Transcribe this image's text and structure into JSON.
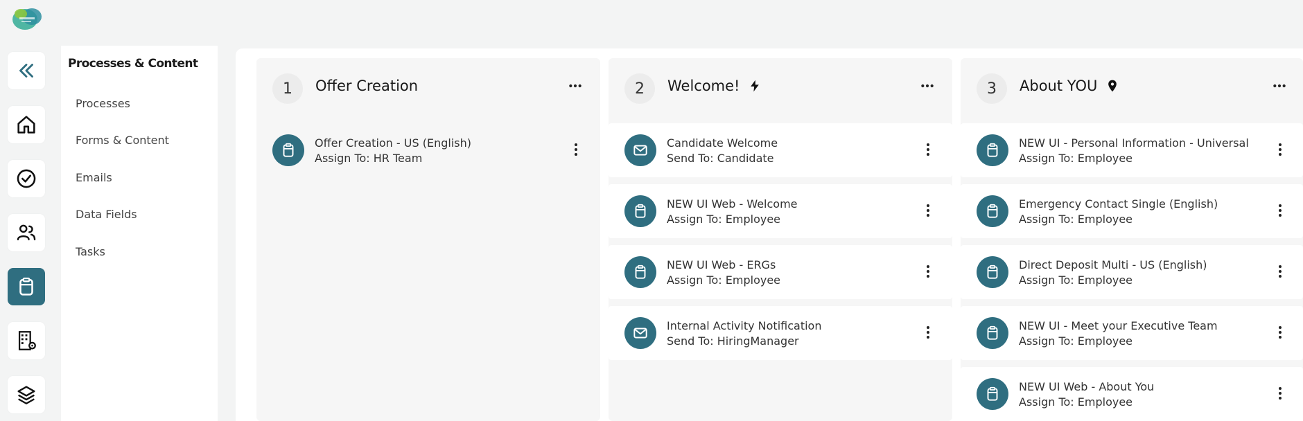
{
  "sidebar": {
    "icons": [
      "collapse-icon",
      "home-icon",
      "check-circle-icon",
      "people-icon",
      "clipboard-icon",
      "building-gear-icon",
      "layers-icon"
    ],
    "active_index": 4
  },
  "subnav": {
    "title": "Processes & Content",
    "items": [
      {
        "label": "Processes"
      },
      {
        "label": "Forms & Content"
      },
      {
        "label": "Emails"
      },
      {
        "label": "Data Fields"
      },
      {
        "label": "Tasks"
      }
    ]
  },
  "columns": [
    {
      "number": "1",
      "title": "Offer Creation",
      "title_icon": "",
      "steps": [
        {
          "icon": "clipboard-icon",
          "name": "Offer Creation - US (English)",
          "assign": "Assign To: HR Team"
        }
      ]
    },
    {
      "number": "2",
      "title": "Welcome!",
      "title_icon": "lightning-icon",
      "steps": [
        {
          "icon": "envelope-icon",
          "name": "Candidate Welcome",
          "assign": "Send To: Candidate"
        },
        {
          "icon": "clipboard-icon",
          "name": "NEW UI Web - Welcome",
          "assign": "Assign To: Employee"
        },
        {
          "icon": "clipboard-icon",
          "name": "NEW UI Web - ERGs",
          "assign": "Assign To: Employee"
        },
        {
          "icon": "envelope-icon",
          "name": "Internal Activity Notification",
          "assign": "Send To: HiringManager"
        }
      ]
    },
    {
      "number": "3",
      "title": "About YOU",
      "title_icon": "map-pin-icon",
      "steps": [
        {
          "icon": "clipboard-icon",
          "name": "NEW UI - Personal Information - Universal",
          "assign": "Assign To: Employee"
        },
        {
          "icon": "clipboard-icon",
          "name": "Emergency Contact Single (English)",
          "assign": "Assign To: Employee"
        },
        {
          "icon": "clipboard-icon",
          "name": "Direct Deposit Multi - US (English)",
          "assign": "Assign To: Employee"
        },
        {
          "icon": "clipboard-icon",
          "name": "NEW UI - Meet your Executive Team",
          "assign": "Assign To: Employee"
        },
        {
          "icon": "clipboard-icon",
          "name": "NEW UI Web - About You",
          "assign": "Assign To: Employee"
        }
      ]
    }
  ],
  "colors": {
    "accent": "#2f6e80",
    "background": "#f3f4f4"
  }
}
